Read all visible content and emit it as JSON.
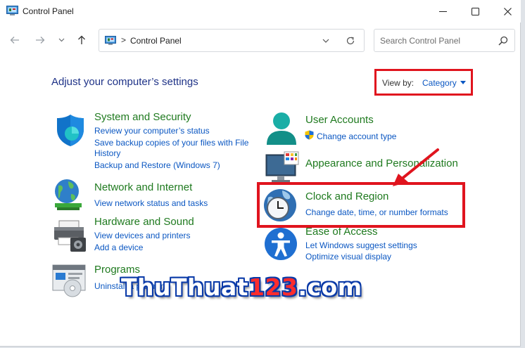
{
  "window": {
    "title": "Control Panel",
    "controls": {
      "minimize": "minimize-icon",
      "maximize": "maximize-icon",
      "close": "close-icon"
    }
  },
  "nav": {
    "back": "back-arrow-icon",
    "forward": "forward-arrow-icon",
    "recent": "chevron-down-icon",
    "up": "up-arrow-icon"
  },
  "address": {
    "separator": ">",
    "crumb": "Control Panel"
  },
  "search": {
    "placeholder": "Search Control Panel"
  },
  "header": {
    "title": "Adjust your computer’s settings"
  },
  "view_by": {
    "label": "View by:",
    "value": "Category"
  },
  "categories": {
    "system": {
      "title": "System and Security",
      "links": [
        "Review your computer’s status",
        "Save backup copies of your files with File",
        "History",
        "Backup and Restore (Windows 7)"
      ]
    },
    "network": {
      "title": "Network and Internet",
      "links": [
        "View network status and tasks"
      ]
    },
    "hardware": {
      "title": "Hardware and Sound",
      "links": [
        "View devices and printers",
        "Add a device"
      ]
    },
    "programs": {
      "title": "Programs",
      "links": [
        "Uninstall a program"
      ]
    },
    "accounts": {
      "title": "User Accounts",
      "links": [
        "Change account type"
      ]
    },
    "appearance": {
      "title": "Appearance and Personalization",
      "links": []
    },
    "clock": {
      "title": "Clock and Region",
      "links": [
        "Change date, time, or number formats"
      ]
    },
    "ease": {
      "title": "Ease of Access",
      "links": [
        "Let Windows suggest settings",
        "Optimize visual display"
      ]
    }
  },
  "watermark": {
    "part1": "ThuThuat",
    "part2": "123",
    "part3": ".com"
  },
  "colors": {
    "accent": "#0b57c2",
    "category_title": "#1f7a1f",
    "highlight": "#e0141e",
    "heading": "#1e3287"
  }
}
